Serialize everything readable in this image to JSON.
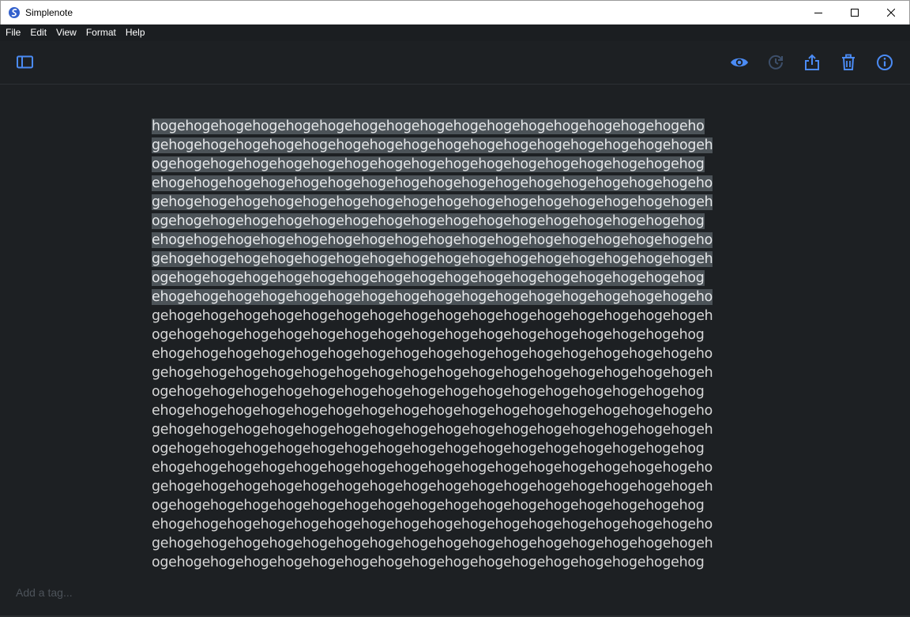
{
  "window": {
    "title": "Simplenote"
  },
  "menu": {
    "items": [
      "File",
      "Edit",
      "View",
      "Format",
      "Help"
    ]
  },
  "toolbar": {
    "sidebar_toggle": "sidebar-toggle-icon",
    "actions": [
      "preview-eye-icon",
      "history-icon",
      "share-icon",
      "trash-icon",
      "info-icon"
    ]
  },
  "note": {
    "lines": [
      "hogehogehogehogehogehogehogehogehogehogehogehogehogehogehogehogeho",
      "gehogehogehogehogehogehogehogehogehogehogehogehogehogehogehogehogeh",
      "ogehogehogehogehogehogehogehogehogehogehogehogehogehogehogehogehog",
      "ehogehogehogehogehogehogehogehogehogehogehogehogehogehogehogehogeho",
      "gehogehogehogehogehogehogehogehogehogehogehogehogehogehogehogehogeh",
      "ogehogehogehogehogehogehogehogehogehogehogehogehogehogehogehogehog",
      "ehogehogehogehogehogehogehogehogehogehogehogehogehogehogehogehogeho",
      "gehogehogehogehogehogehogehogehogehogehogehogehogehogehogehogehogeh",
      "ogehogehogehogehogehogehogehogehogehogehogehogehogehogehogehogehog",
      "ehogehogehogehogehogehogehogehogehogehogehogehogehogehogehogehogeho",
      "gehogehogehogehogehogehogehogehogehogehogehogehogehogehogehogehogeh",
      "ogehogehogehogehogehogehogehogehogehogehogehogehogehogehogehogehog",
      "ehogehogehogehogehogehogehogehogehogehogehogehogehogehogehogehogeho",
      "gehogehogehogehogehogehogehogehogehogehogehogehogehogehogehogehogeh",
      "ogehogehogehogehogehogehogehogehogehogehogehogehogehogehogehogehog",
      "ehogehogehogehogehogehogehogehogehogehogehogehogehogehogehogehogeho",
      "gehogehogehogehogehogehogehogehogehogehogehogehogehogehogehogehogeh",
      "ogehogehogehogehogehogehogehogehogehogehogehogehogehogehogehogehog",
      "ehogehogehogehogehogehogehogehogehogehogehogehogehogehogehogehogeho",
      "gehogehogehogehogehogehogehogehogehogehogehogehogehogehogehogehogeh",
      "ogehogehogehogehogehogehogehogehogehogehogehogehogehogehogehogehog",
      "ehogehogehogehogehogehogehogehogehogehogehogehogehogehogehogehogeho",
      "gehogehogehogehogehogehogehogehogehogehogehogehogehogehogehogehogeh",
      "ogehogehogehogehogehogehogehogehogehogehogehogehogehogehogehogehog"
    ],
    "selected_line_count": 10
  },
  "tags": {
    "placeholder": "Add a tag..."
  },
  "colors": {
    "accent": "#4b8bf4",
    "accent_disabled": "#3d4f6a",
    "background": "#1d2023",
    "selection": "#4c5358"
  }
}
